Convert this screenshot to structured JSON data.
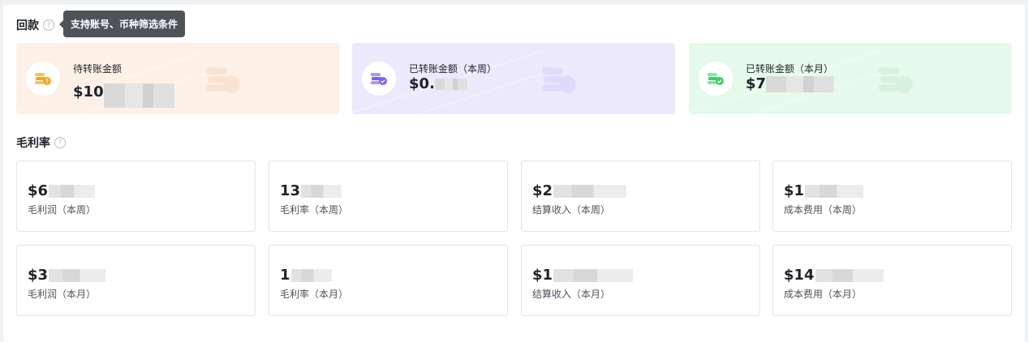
{
  "payback": {
    "title": "回款",
    "tooltip": "支持账号、币种筛选条件",
    "cards": [
      {
        "label": "待转账金额",
        "value_prefix": "$1",
        "value_suffix": "0",
        "icon": "coins-warning-icon"
      },
      {
        "label": "已转账金额（本周）",
        "value_prefix": "$0",
        "value_suffix": ".",
        "icon": "coins-check-icon"
      },
      {
        "label": "已转账金额（本月）",
        "value_prefix": "$7",
        "value_suffix": "",
        "icon": "coins-check-icon"
      }
    ]
  },
  "gross_margin": {
    "title": "毛利率",
    "cards": [
      {
        "value_prefix": "$6",
        "label": "毛利润（本周）"
      },
      {
        "value_prefix": "13",
        "label": "毛利率（本周）"
      },
      {
        "value_prefix": "$2",
        "label": "结算收入（本周）"
      },
      {
        "value_prefix": "$1",
        "label": "成本费用（本周）"
      },
      {
        "value_prefix": "$3",
        "label": "毛利润（本月）"
      },
      {
        "value_prefix": "1",
        "label": "毛利率（本月）"
      },
      {
        "value_prefix": "$1",
        "label": "结算收入（本月）"
      },
      {
        "value_prefix": "$14",
        "label": "成本费用（本月）"
      }
    ]
  },
  "colors": {
    "orange_bg": "#fdf1e7",
    "purple_bg": "#ece9fd",
    "green_bg": "#e6faeb",
    "orange_icon": "#f5a623",
    "purple_icon": "#7b61ff",
    "green_icon": "#3ccf6a"
  }
}
